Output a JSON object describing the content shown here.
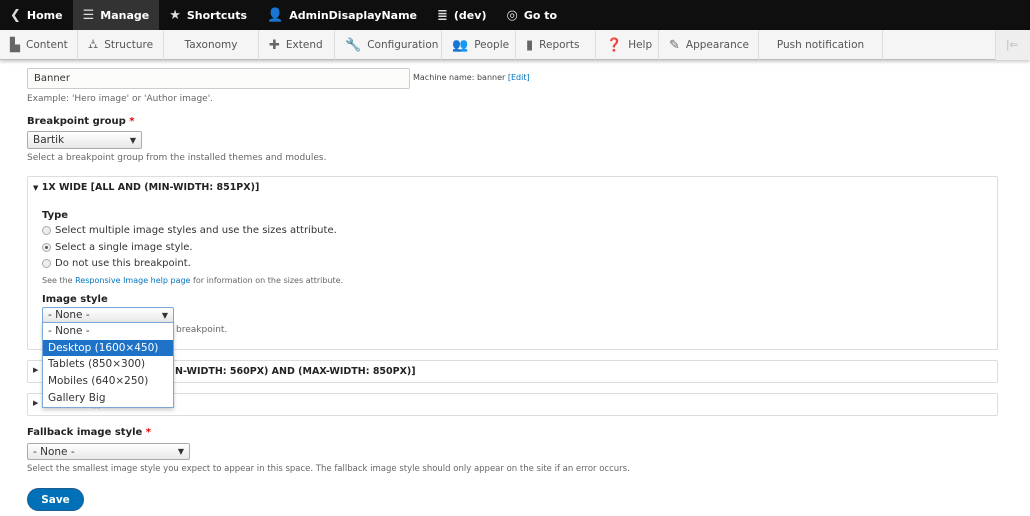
{
  "toolbar": {
    "items": [
      {
        "label": "Home",
        "icon": "chevron-left-circle-icon"
      },
      {
        "label": "Manage",
        "icon": "menu-icon",
        "active": true
      },
      {
        "label": "Shortcuts",
        "icon": "star-icon"
      },
      {
        "label": "AdminDisaplayName",
        "icon": "user-icon"
      },
      {
        "label": "(dev)",
        "icon": "server-icon"
      },
      {
        "label": "Go to",
        "icon": "search-circle-icon"
      }
    ]
  },
  "tray": {
    "items": [
      {
        "label": "Content",
        "icon": "file-icon"
      },
      {
        "label": "Structure",
        "icon": "sitemap-icon"
      },
      {
        "label": "Taxonomy"
      },
      {
        "label": "Extend",
        "icon": "puzzle-icon"
      },
      {
        "label": "Configuration",
        "icon": "wrench-icon"
      },
      {
        "label": "People",
        "icon": "people-icon"
      },
      {
        "label": "Reports",
        "icon": "bar-chart-icon"
      },
      {
        "label": "Help",
        "icon": "help-icon"
      },
      {
        "label": "Appearance",
        "icon": "brush-icon"
      },
      {
        "label": "Push notification"
      }
    ],
    "collapse_icon": "collapse-left-icon"
  },
  "form": {
    "label_input": {
      "value": "Banner",
      "machine_name_prefix": "Machine name: banner",
      "edit_link": "[Edit]",
      "description": "Example: 'Hero image' or 'Author image'."
    },
    "breakpoint_group": {
      "label": "Breakpoint group",
      "required": "*",
      "value": "Bartik",
      "description": "Select a breakpoint group from the installed themes and modules."
    },
    "details_wide": {
      "summary": "1x Wide [all and (min-width: 851px)]",
      "type_label": "Type",
      "radios": [
        "Select multiple image styles and use the sizes attribute.",
        "Select a single image style.",
        "Do not use this breakpoint."
      ],
      "selected_radio": 1,
      "help_pre": "See the ",
      "help_link": "Responsive Image help page",
      "help_post": " for information on the sizes attribute.",
      "image_style_label": "Image style",
      "image_style_value": "- None -",
      "image_style_desc_visible": "breakpoint.",
      "dropdown_options": [
        "- None -",
        "Desktop (1600×450)",
        "Tablets (850×300)",
        "Mobiles (640×250)",
        "Gallery Big"
      ],
      "highlighted_option": 1
    },
    "details_narrow": {
      "summary_visible": "N-WIDTH: 560PX) AND (MAX-WIDTH: 850PX)]"
    },
    "details_mobile": {
      "summary_visible": "[]"
    },
    "fallback": {
      "label": "Fallback image style",
      "required": "*",
      "value": "- None -",
      "description": "Select the smallest image style you expect to appear in this space. The fallback image style should only appear on the site if an error occurs."
    },
    "save": "Save"
  }
}
